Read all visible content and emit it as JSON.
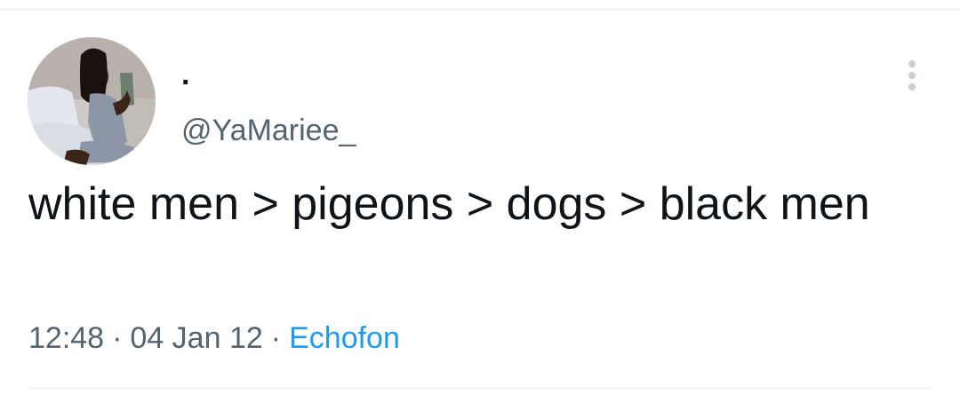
{
  "tweet": {
    "display_name": ".",
    "handle": "@YaMariee_",
    "text": "white men > pigeons > dogs > black men",
    "time": "12:48",
    "separator": "·",
    "date": "04 Jan 12",
    "source": "Echofon"
  },
  "icons": {
    "more": "more-vertical-icon",
    "avatar": "profile-photo"
  },
  "colors": {
    "text_primary": "#0f1419",
    "text_secondary": "#536471",
    "link": "#1d9bf0",
    "divider": "#e6ecf0",
    "more_icon": "#c4cfd6"
  }
}
